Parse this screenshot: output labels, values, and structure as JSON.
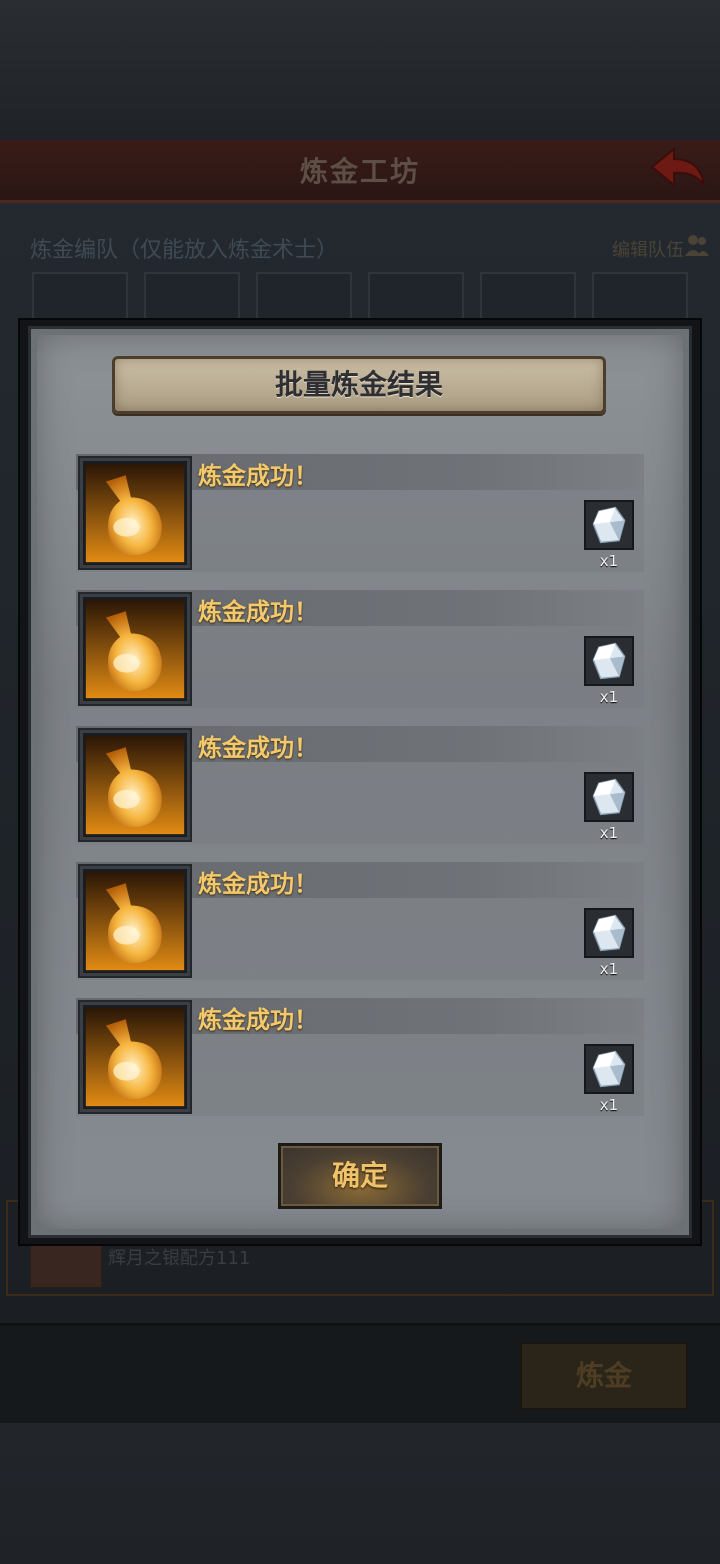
{
  "background": {
    "header_title": "炼金工坊",
    "team_label": "炼金编队（仅能放入炼金术士）",
    "edit_team_label": "编辑队伍",
    "row_item_text": "辉月之银配方111",
    "alchemy_button": "炼金"
  },
  "modal": {
    "title": "批量炼金结果",
    "results": [
      {
        "status": "炼金成功！",
        "reward_icon": "crystal-icon",
        "quantity": "x1"
      },
      {
        "status": "炼金成功！",
        "reward_icon": "crystal-icon",
        "quantity": "x1"
      },
      {
        "status": "炼金成功！",
        "reward_icon": "crystal-icon",
        "quantity": "x1"
      },
      {
        "status": "炼金成功！",
        "reward_icon": "crystal-icon",
        "quantity": "x1"
      },
      {
        "status": "炼金成功！",
        "reward_icon": "crystal-icon",
        "quantity": "x1"
      }
    ],
    "confirm_label": "确定"
  },
  "colors": {
    "success_text": "#f3c96b",
    "banner": "#b9ad94",
    "modal_bg": "#868b91"
  }
}
